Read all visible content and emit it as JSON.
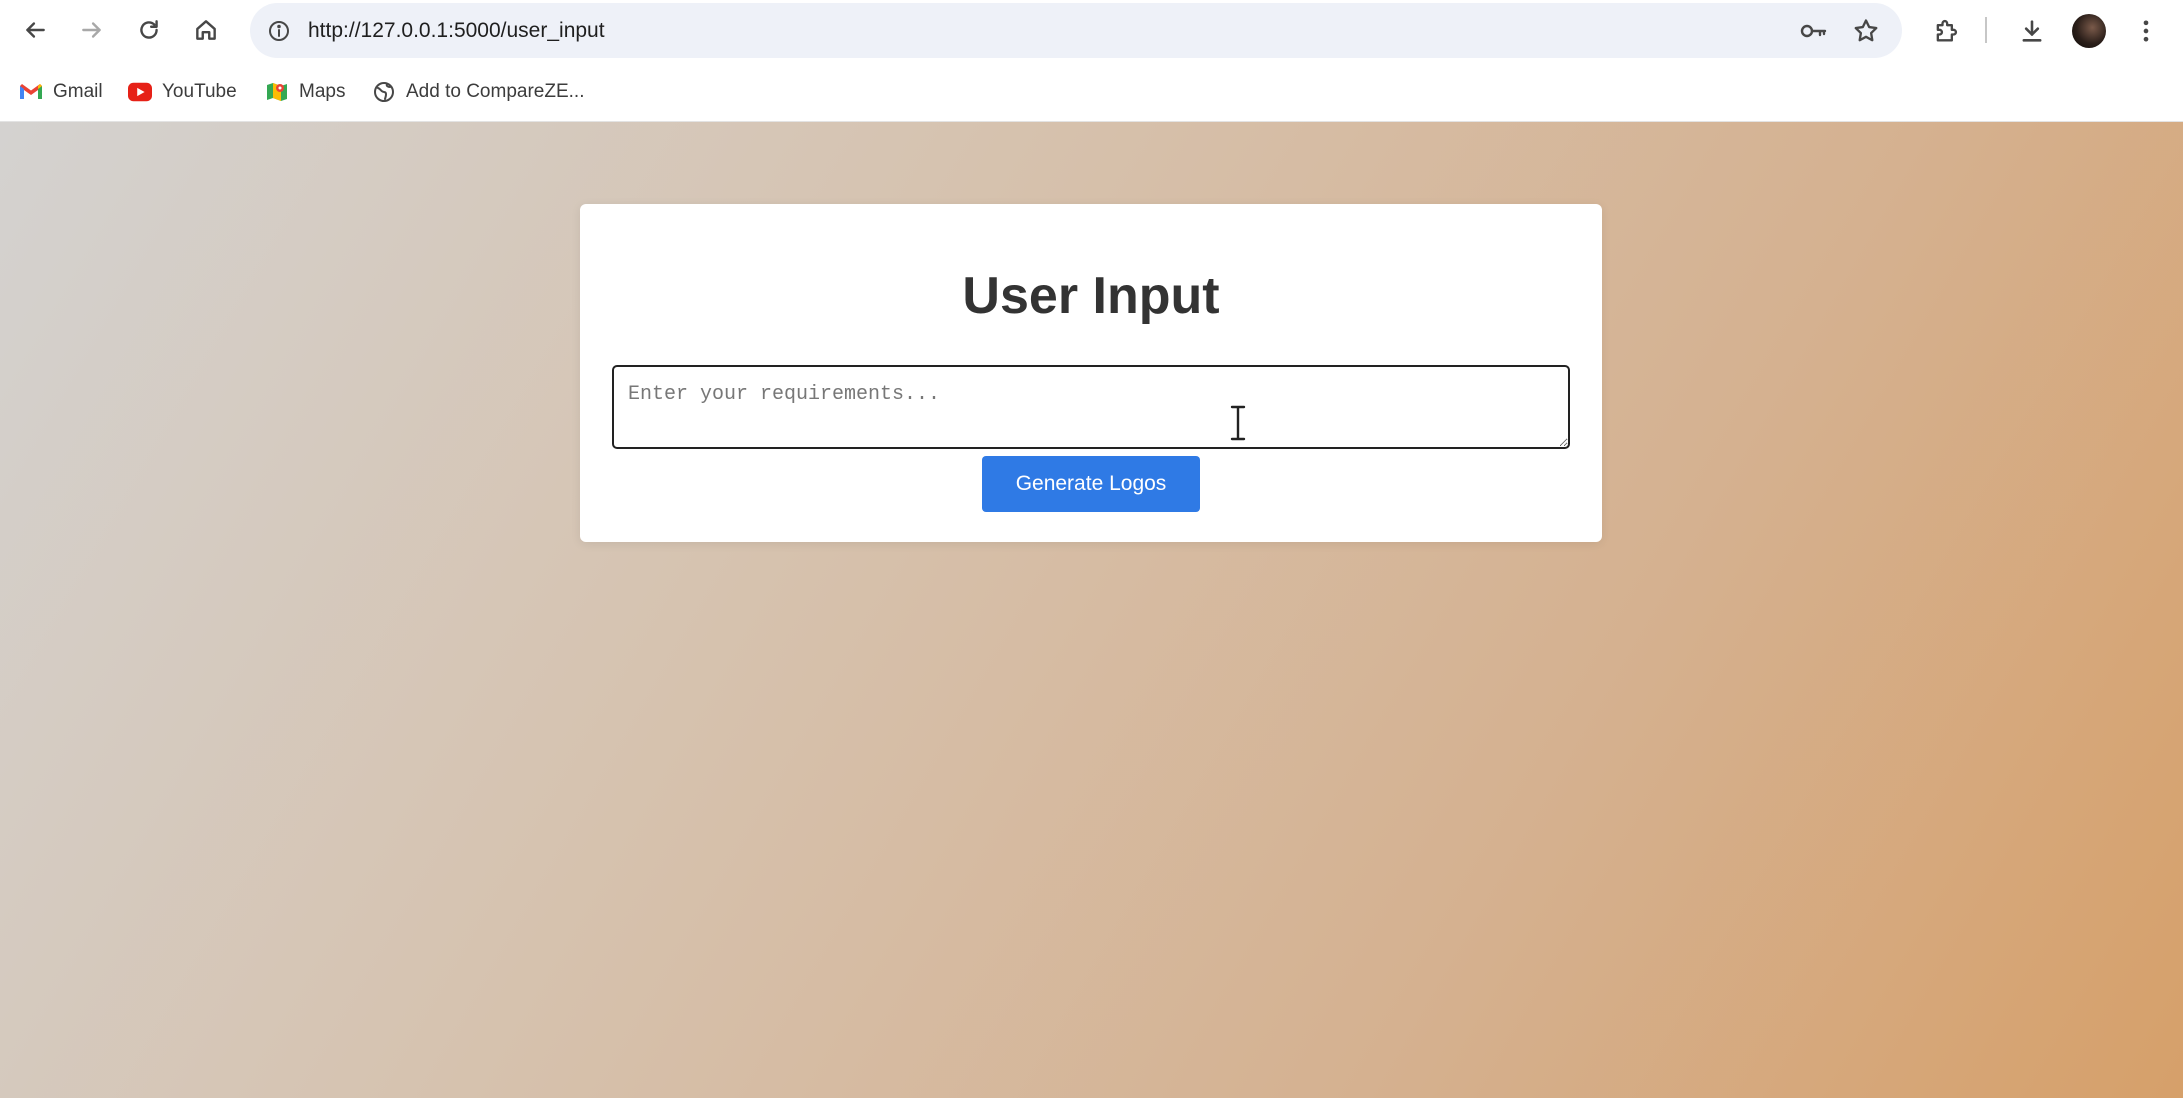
{
  "browser": {
    "url": "http://127.0.0.1:5000/user_input",
    "icons": {
      "back": "arrow-left-icon",
      "forward": "arrow-right-icon",
      "reload": "reload-icon",
      "home": "home-icon",
      "site_info": "info-icon",
      "password": "key-icon",
      "bookmark_star": "star-icon",
      "extensions": "puzzle-icon",
      "downloads": "download-icon",
      "menu": "kebab-menu-icon"
    }
  },
  "bookmarks": [
    {
      "label": "Gmail",
      "icon": "gmail-icon"
    },
    {
      "label": "YouTube",
      "icon": "youtube-icon"
    },
    {
      "label": "Maps",
      "icon": "maps-icon"
    },
    {
      "label": "Add to CompareZE...",
      "icon": "globe-icon"
    }
  ],
  "page": {
    "title": "User Input",
    "requirements_placeholder": "Enter your requirements...",
    "requirements_value": "",
    "generate_button_label": "Generate Logos"
  },
  "colors": {
    "button_bg": "#2f7ae5",
    "title_text": "#333333",
    "gradient_start": "#d4d2d0",
    "gradient_end": "#d6a06a"
  }
}
